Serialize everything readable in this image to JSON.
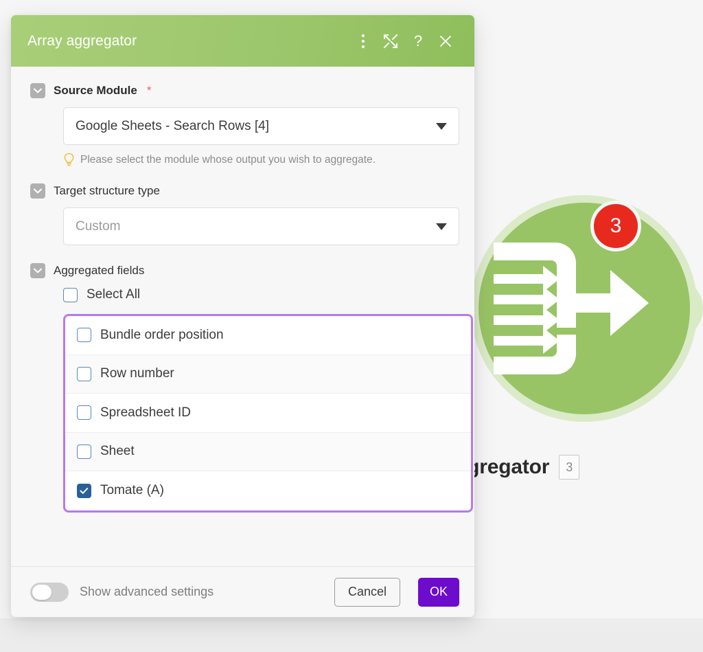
{
  "dialog": {
    "title": "Array aggregator",
    "header_icons": [
      {
        "name": "more-options-icon",
        "glyph": "kebab"
      },
      {
        "name": "expand-icon",
        "glyph": "expand"
      },
      {
        "name": "help-icon",
        "glyph": "question"
      },
      {
        "name": "close-icon",
        "glyph": "close"
      }
    ],
    "sections": {
      "source_module": {
        "label": "Source Module",
        "required_marker": "*",
        "value": "Google Sheets - Search Rows [4]",
        "hint": "Please select the module whose output you wish to aggregate."
      },
      "target_structure": {
        "label": "Target structure type",
        "value": "Custom",
        "is_placeholder": true
      },
      "aggregated_fields": {
        "label": "Aggregated fields",
        "select_all_label": "Select All",
        "select_all_checked": false,
        "fields": [
          {
            "label": "Bundle order position",
            "checked": false
          },
          {
            "label": "Row number",
            "checked": false
          },
          {
            "label": "Spreadsheet ID",
            "checked": false
          },
          {
            "label": "Sheet",
            "checked": false
          },
          {
            "label": "Tomate (A)",
            "checked": true
          }
        ]
      }
    },
    "footer": {
      "advanced_label": "Show advanced settings",
      "advanced_on": false,
      "cancel_label": "Cancel",
      "ok_label": "OK"
    }
  },
  "canvas": {
    "module_label": "Array aggregator",
    "module_label_chip": "3",
    "module_badge": "3",
    "add_button_icon": "plus-icon"
  },
  "colors": {
    "header_green_start": "#a9ce79",
    "header_green_end": "#8fbe5c",
    "node_green": "#98c465",
    "node_halo_green": "#d6e8c0",
    "badge_red": "#e8291e",
    "ok_purple": "#6d0ccc",
    "list_border_purple": "#b579ef",
    "checkbox_blue": "#2a6099",
    "hint_yellow": "#f0c040",
    "required_red": "#e9606a"
  }
}
